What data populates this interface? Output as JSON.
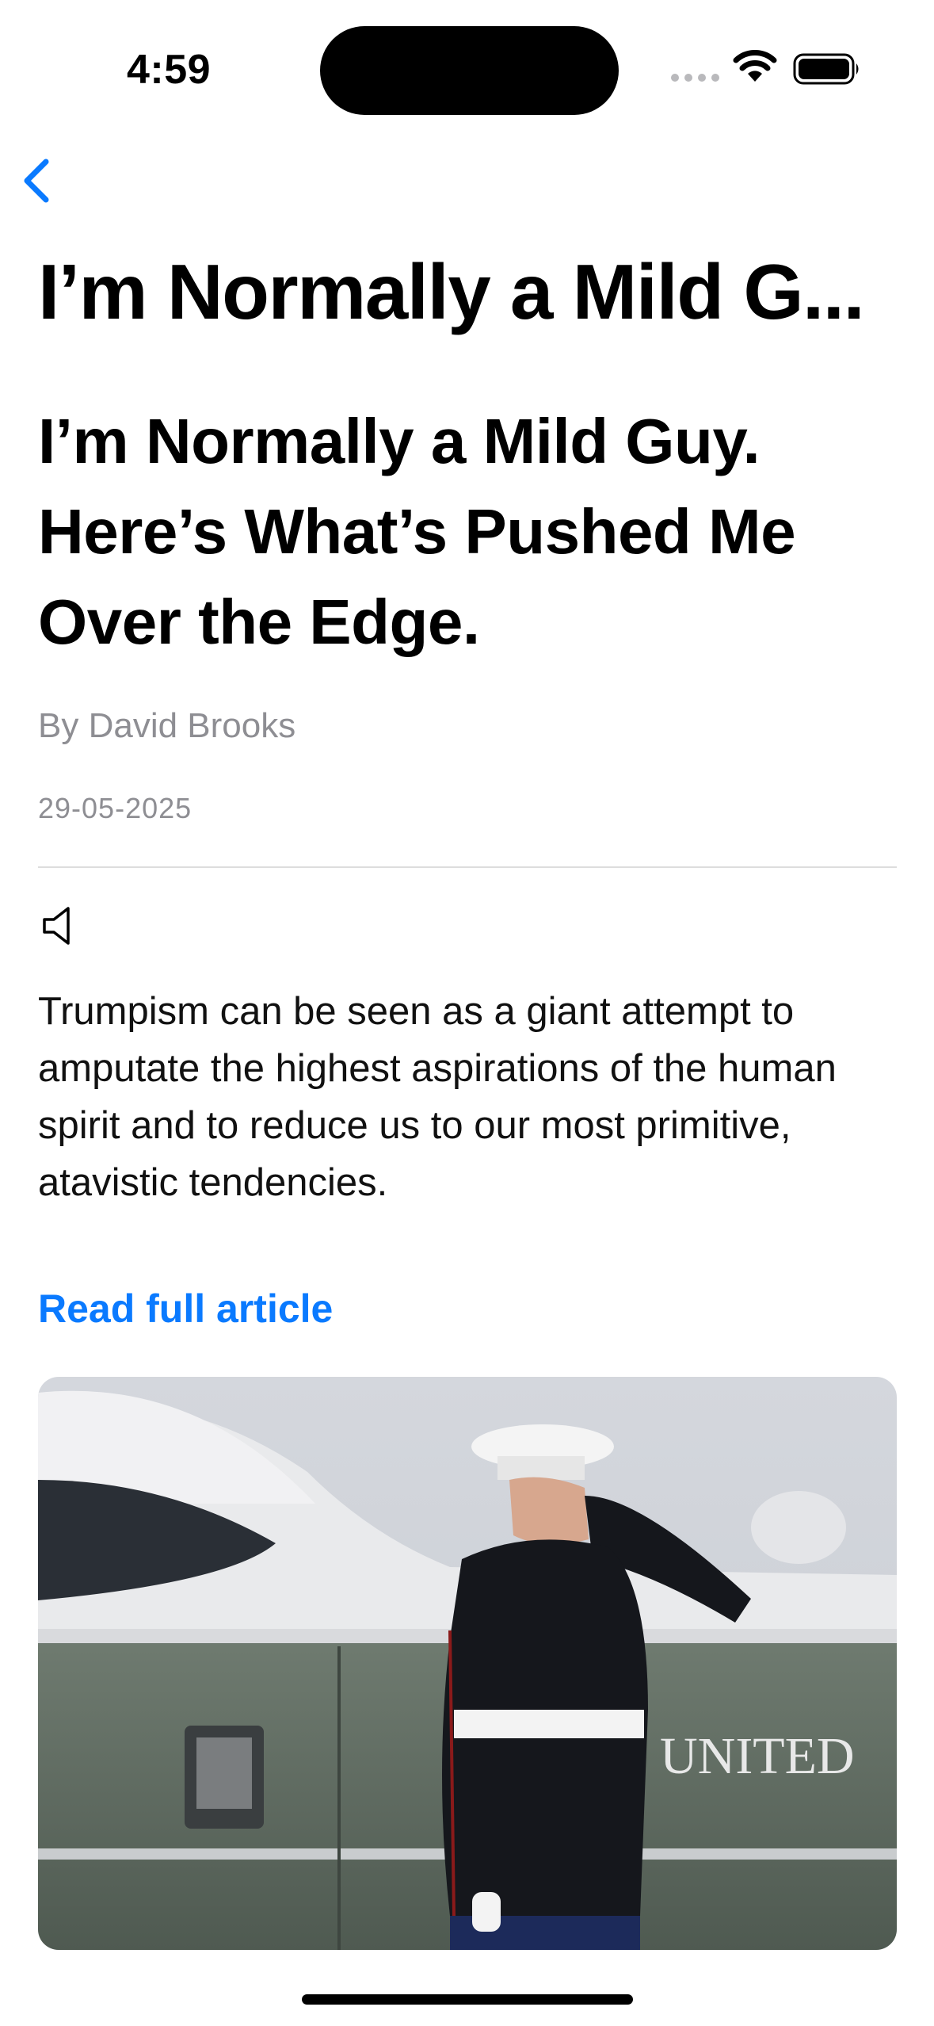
{
  "status_bar": {
    "time": "4:59"
  },
  "nav": {
    "back_icon": "chevron-left-icon",
    "title": "I’m Normally a Mild G..."
  },
  "article": {
    "headline": "I’m Normally a Mild Guy. Here’s What’s Pushed Me Over the Edge.",
    "byline": "By David Brooks",
    "date": "29-05-2025",
    "audio_icon": "speaker-icon",
    "summary": "Trumpism can be seen as a giant attempt to amputate the highest aspirations of the human spirit and to reduce us to our most primitive, atavistic tendencies.",
    "read_more_label": "Read full article",
    "image_text": "UNITED"
  },
  "colors": {
    "accent": "#0a7aff",
    "secondary_text": "#8e8e93"
  }
}
